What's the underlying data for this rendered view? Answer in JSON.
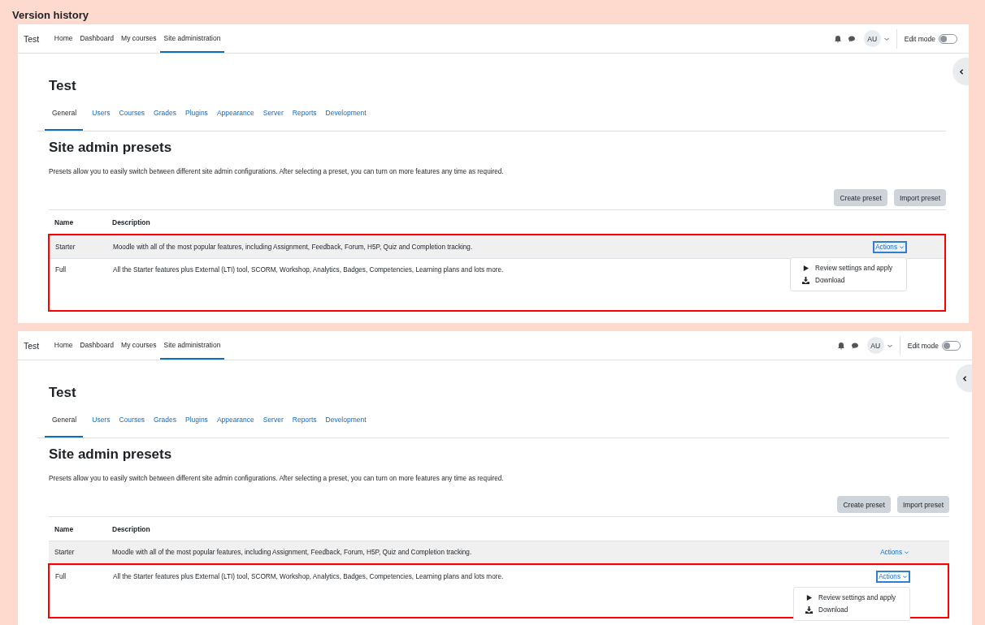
{
  "title": "Version history",
  "panels": [
    {
      "brand": "Test",
      "nav": [
        {
          "label": "Home",
          "selected": false
        },
        {
          "label": "Dashboard",
          "selected": false
        },
        {
          "label": "My courses",
          "selected": false
        },
        {
          "label": "Site administration",
          "selected": true
        }
      ],
      "avatar": "AU",
      "edit_mode": {
        "label": "Edit mode",
        "on": false
      },
      "heading": "Test",
      "tabs": [
        {
          "label": "General",
          "selected": true
        },
        {
          "label": "Users",
          "selected": false
        },
        {
          "label": "Courses",
          "selected": false
        },
        {
          "label": "Grades",
          "selected": false
        },
        {
          "label": "Plugins",
          "selected": false
        },
        {
          "label": "Appearance",
          "selected": false
        },
        {
          "label": "Server",
          "selected": false
        },
        {
          "label": "Reports",
          "selected": false
        },
        {
          "label": "Development",
          "selected": false
        }
      ],
      "page_title": "Site admin presets",
      "intro": "Presets allow you to easily switch between different site admin configurations. After selecting a preset, you can turn on more features any time as required.",
      "buttons": [
        "Create preset",
        "Import preset"
      ],
      "columns": [
        "Name",
        "Description"
      ],
      "rows": [
        {
          "name": "Starter",
          "description": "Moodle with all of the most popular features, including Assignment, Feedback, Forum, H5P, Quiz and Completion tracking.",
          "actions": "Actions",
          "hovered": true,
          "focused": true,
          "outlined": true,
          "menu": [
            {
              "kind": "play",
              "label": "Review settings and apply"
            },
            {
              "kind": "download",
              "label": "Download"
            }
          ]
        },
        {
          "name": "Full",
          "description": "All the Starter features plus External (LTI) tool, SCORM, Workshop, Analytics, Badges, Competencies, Learning plans and lots more.",
          "hovered": false,
          "outlined": true
        }
      ]
    },
    {
      "brand": "Test",
      "nav": [
        {
          "label": "Home",
          "selected": false
        },
        {
          "label": "Dashboard",
          "selected": false
        },
        {
          "label": "My courses",
          "selected": false
        },
        {
          "label": "Site administration",
          "selected": true
        }
      ],
      "avatar": "AU",
      "edit_mode": {
        "label": "Edit mode",
        "on": false
      },
      "heading": "Test",
      "tabs": [
        {
          "label": "General",
          "selected": true
        },
        {
          "label": "Users",
          "selected": false
        },
        {
          "label": "Courses",
          "selected": false
        },
        {
          "label": "Grades",
          "selected": false
        },
        {
          "label": "Plugins",
          "selected": false
        },
        {
          "label": "Appearance",
          "selected": false
        },
        {
          "label": "Server",
          "selected": false
        },
        {
          "label": "Reports",
          "selected": false
        },
        {
          "label": "Development",
          "selected": false
        }
      ],
      "page_title": "Site admin presets",
      "intro": "Presets allow you to easily switch between different site admin configurations. After selecting a preset, you can turn on more features any time as required.",
      "buttons": [
        "Create preset",
        "Import preset"
      ],
      "columns": [
        "Name",
        "Description"
      ],
      "rows": [
        {
          "name": "Starter",
          "description": "Moodle with all of the most popular features, including Assignment, Feedback, Forum, H5P, Quiz and Completion tracking.",
          "actions": "Actions",
          "hovered": true,
          "focused": false,
          "outlined": false
        },
        {
          "name": "Full",
          "description": "All the Starter features plus External (LTI) tool, SCORM, Workshop, Analytics, Badges, Competencies, Learning plans and lots more.",
          "actions": "Actions",
          "hovered": false,
          "focused": true,
          "outlined": true,
          "menu": [
            {
              "kind": "play",
              "label": "Review settings and apply"
            },
            {
              "kind": "download",
              "label": "Download"
            }
          ]
        }
      ]
    }
  ]
}
